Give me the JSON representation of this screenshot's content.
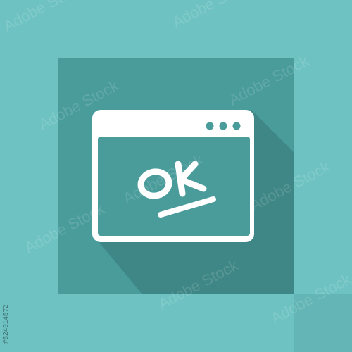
{
  "icon": {
    "semantic": "browser-window-ok-icon",
    "text": "OK"
  },
  "colors": {
    "background": "#6ec3c2",
    "tile": "#4a9c9b",
    "tile_shadow": "#3f8786",
    "window_frame": "#ffffff",
    "window_content": "#4a9c9b",
    "dots": "#4a9c9b"
  },
  "watermark": {
    "text": "Adobe Stock",
    "stock_id": "#524914572"
  }
}
